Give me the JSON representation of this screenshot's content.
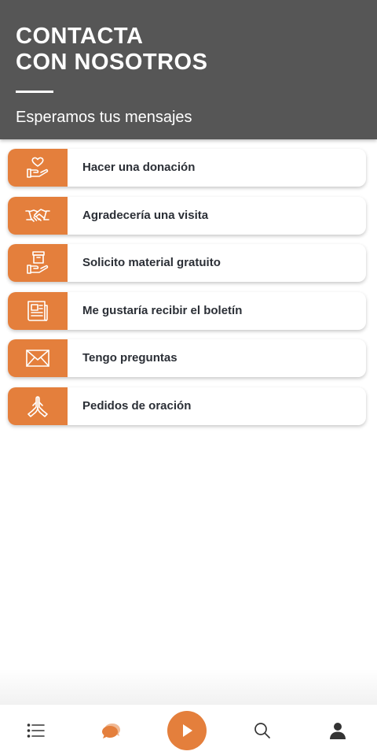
{
  "header": {
    "title_line1": "CONTACTA",
    "title_line2": "CON NOSOTROS",
    "subtitle": "Esperamos tus mensajes"
  },
  "menu": {
    "items": [
      {
        "label": "Hacer una donación",
        "icon": "heart-hand-icon"
      },
      {
        "label": "Agradecería una visita",
        "icon": "handshake-icon"
      },
      {
        "label": "Solicito material gratuito",
        "icon": "box-hand-icon"
      },
      {
        "label": "Me gustaría recibir el boletín",
        "icon": "newsletter-icon"
      },
      {
        "label": "Tengo preguntas",
        "icon": "envelope-icon"
      },
      {
        "label": "Pedidos de oración",
        "icon": "praying-hands-icon"
      }
    ]
  },
  "bottom_nav": {
    "items": [
      "list-icon",
      "chat-icon",
      "play-icon",
      "search-icon",
      "user-icon"
    ]
  },
  "colors": {
    "accent": "#e47f3c",
    "header_bg": "#565656",
    "label_text": "#2b2f36"
  }
}
